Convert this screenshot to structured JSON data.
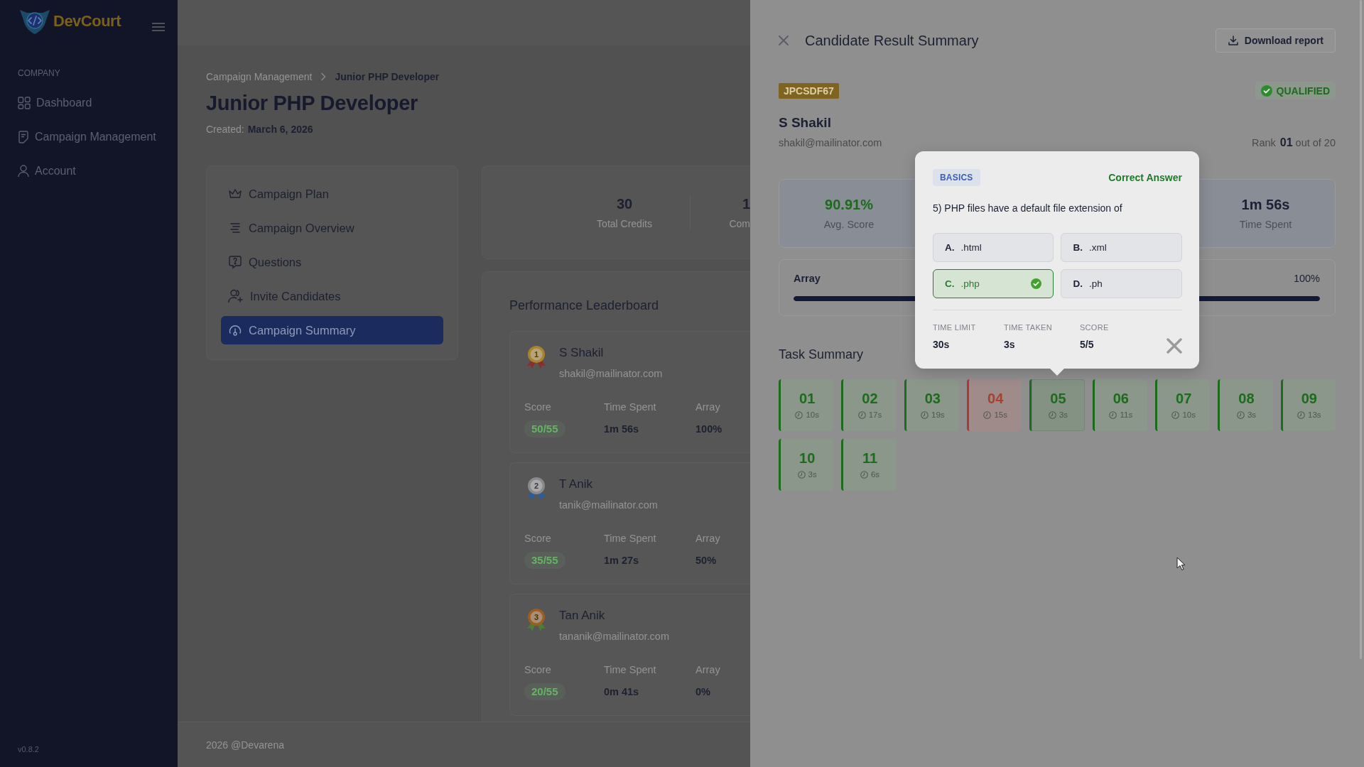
{
  "sidebar": {
    "brand": "DevCourt",
    "section": "COMPANY",
    "items": [
      {
        "label": "Dashboard",
        "selected": false
      },
      {
        "label": "Campaign Management",
        "selected": false
      },
      {
        "label": "Account",
        "selected": false
      }
    ],
    "version": "v0.8.2"
  },
  "page": {
    "breadcrumb": [
      "Campaign Management",
      "Junior PHP Developer"
    ],
    "title": "Junior PHP Developer",
    "created_label": "Created:",
    "created_date": "March 6, 2026",
    "nav": [
      {
        "label": "Campaign Plan",
        "selected": false
      },
      {
        "label": "Campaign Overview",
        "selected": false
      },
      {
        "label": "Questions",
        "selected": false
      },
      {
        "label": "Invite Candidates",
        "selected": false
      },
      {
        "label": "Campaign Summary",
        "selected": true
      }
    ],
    "stats": [
      {
        "value": "30",
        "label": "Total Credits"
      },
      {
        "value": "1",
        "label": "Com"
      }
    ],
    "leaderboard": {
      "title": "Performance Leaderboard",
      "entries": [
        {
          "rank": "1",
          "kind": "gold",
          "name": "S Shakil",
          "email": "shakil@mailinator.com",
          "fields": [
            {
              "kind": "pill",
              "label": "Score",
              "value": "50/55"
            },
            {
              "kind": "plain",
              "label": "Time Spent",
              "value": "1m 56s"
            },
            {
              "kind": "plain",
              "label": "Array",
              "value": "100%"
            }
          ]
        },
        {
          "rank": "2",
          "kind": "silver",
          "name": "T Anik",
          "email": "tanik@mailinator.com",
          "fields": [
            {
              "kind": "pill",
              "label": "Score",
              "value": "35/55"
            },
            {
              "kind": "plain",
              "label": "Time Spent",
              "value": "1m 27s"
            },
            {
              "kind": "plain",
              "label": "Array",
              "value": "50%"
            }
          ]
        },
        {
          "rank": "3",
          "kind": "bronze",
          "name": "Tan Anik",
          "email": "tananik@mailinator.com",
          "fields": [
            {
              "kind": "pill",
              "label": "Score",
              "value": "20/55"
            },
            {
              "kind": "plain",
              "label": "Time Spent",
              "value": "0m 41s"
            },
            {
              "kind": "plain",
              "label": "Array",
              "value": "0%"
            }
          ]
        }
      ]
    },
    "footer": "2026 @Devarena"
  },
  "drawer": {
    "title": "Candidate Result Summary",
    "download_button": "Download report",
    "code": "JPCSDF67",
    "status": "QUALIFIED",
    "candidate": {
      "name": "S Shakil",
      "email": "shakil@mailinator.com",
      "rank_label": "Rank",
      "rank": "01",
      "rank_total": "out of 20"
    },
    "stats": [
      {
        "kind": "highlight",
        "value": "90.91%",
        "label": "Avg. Score"
      },
      {
        "kind": "plain",
        "value": "1m 56s",
        "label": "Time Spent"
      }
    ],
    "skills": [
      {
        "name": "Array",
        "reading": "100%",
        "level": 1
      }
    ],
    "task_summary": {
      "title": "Task Summary",
      "tasks": [
        {
          "number": "01",
          "time": "10s",
          "correct": true,
          "selected": false
        },
        {
          "number": "02",
          "time": "17s",
          "correct": true,
          "selected": false
        },
        {
          "number": "03",
          "time": "19s",
          "correct": true,
          "selected": false
        },
        {
          "number": "04",
          "time": "15s",
          "correct": false,
          "selected": false
        },
        {
          "number": "05",
          "time": "3s",
          "correct": true,
          "selected": true
        },
        {
          "number": "06",
          "time": "11s",
          "correct": true,
          "selected": false
        },
        {
          "number": "07",
          "time": "10s",
          "correct": true,
          "selected": false
        },
        {
          "number": "08",
          "time": "3s",
          "correct": true,
          "selected": false
        },
        {
          "number": "09",
          "time": "13s",
          "correct": true,
          "selected": false
        },
        {
          "number": "10",
          "time": "3s",
          "correct": true,
          "selected": false
        },
        {
          "number": "11",
          "time": "6s",
          "correct": true,
          "selected": false
        }
      ]
    },
    "popover": {
      "category": "BASICS",
      "result": "Correct Answer",
      "question": "5) PHP files have a default file extension of",
      "options": [
        {
          "letter": "A.",
          "text": ".html",
          "correct": false
        },
        {
          "letter": "B.",
          "text": ".xml",
          "correct": false
        },
        {
          "letter": "C.",
          "text": ".php",
          "correct": true
        },
        {
          "letter": "D.",
          "text": ".ph",
          "correct": false
        }
      ],
      "details": [
        {
          "label": "TIME LIMIT",
          "value": "30s"
        },
        {
          "label": "TIME TAKEN",
          "value": "3s"
        },
        {
          "label": "SCORE",
          "value": "5/5"
        }
      ]
    }
  }
}
